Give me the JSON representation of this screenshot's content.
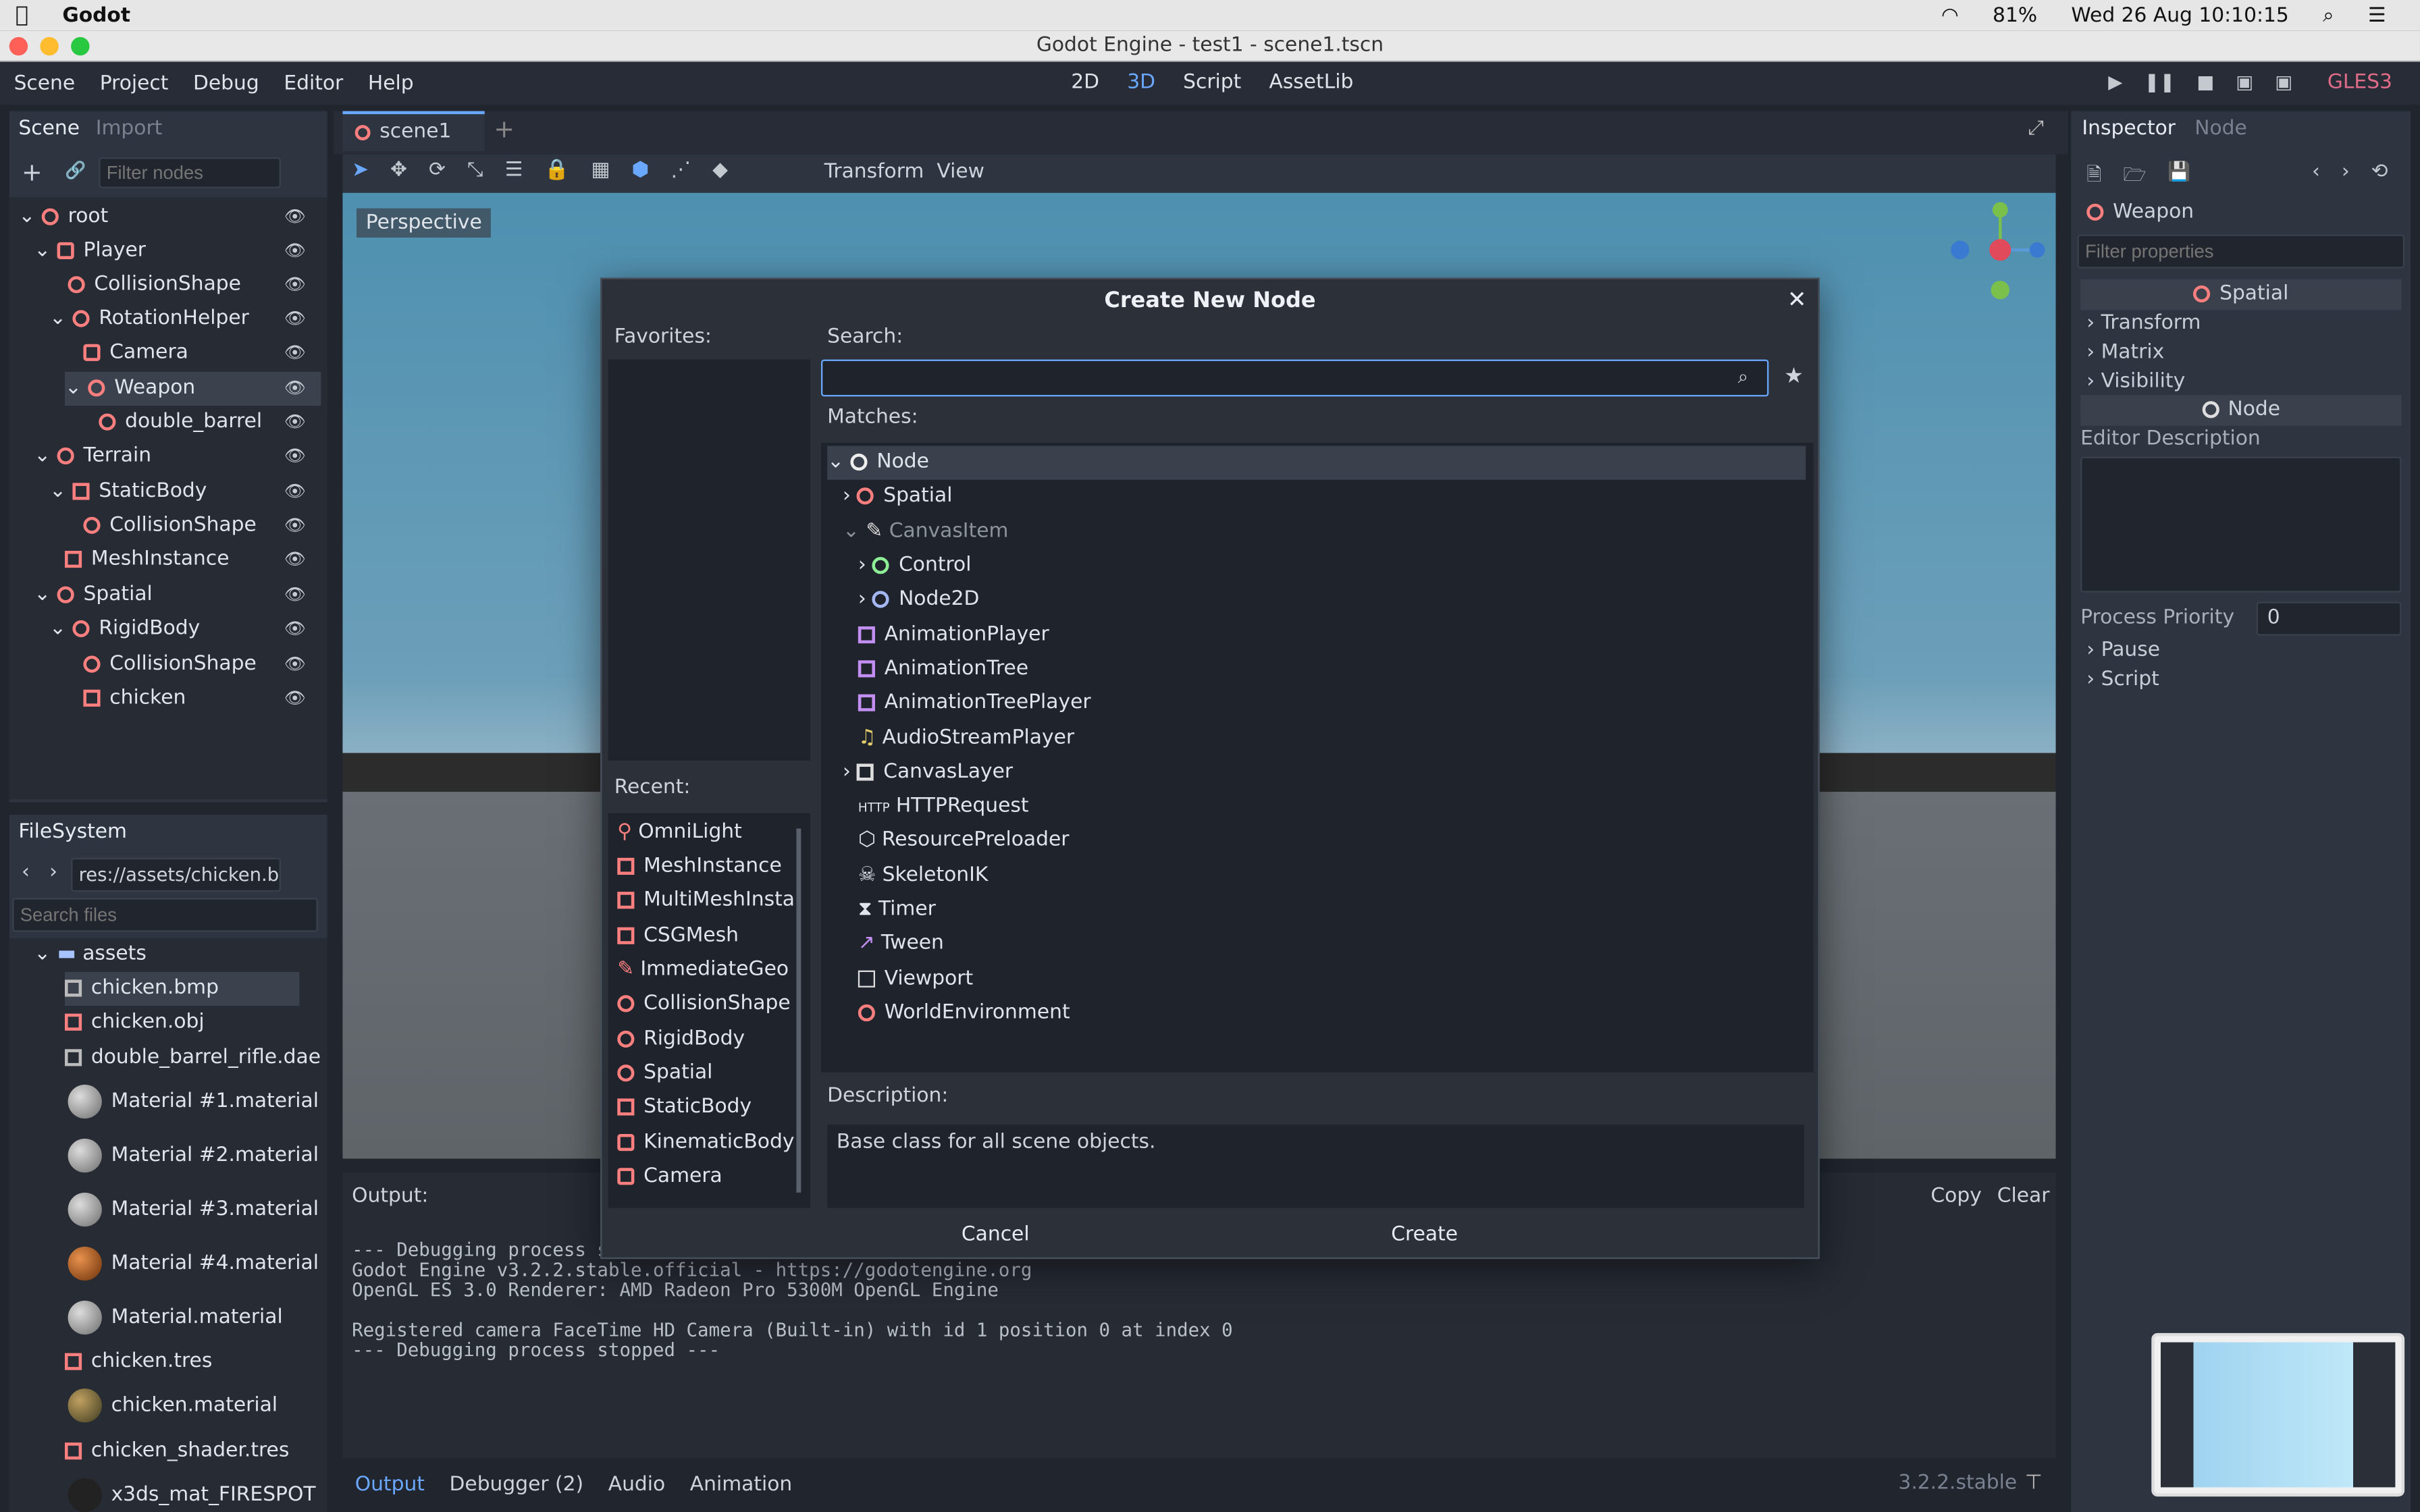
{
  "mac_menubar": {
    "app": "Godot",
    "battery": "81%",
    "datetime": "Wed 26 Aug  10:10:15"
  },
  "window": {
    "title": "Godot Engine - test1 - scene1.tscn"
  },
  "main_menu": [
    "Scene",
    "Project",
    "Debug",
    "Editor",
    "Help"
  ],
  "workspaces": [
    "2D",
    "3D",
    "Script",
    "AssetLib"
  ],
  "renderer": "GLES3",
  "scene_dock": {
    "tab_scene": "Scene",
    "tab_import": "Import",
    "filter_placeholder": "Filter nodes",
    "nodes": [
      "root",
      "Player",
      "CollisionShape",
      "RotationHelper",
      "Camera",
      "Weapon",
      "double_barrel",
      "Terrain",
      "StaticBody",
      "CollisionShape",
      "MeshInstance",
      "Spatial",
      "RigidBody",
      "CollisionShape",
      "chicken"
    ]
  },
  "filesystem": {
    "title": "FileSystem",
    "path": "res://assets/chicken.b",
    "search_placeholder": "Search files",
    "items": [
      "assets",
      "chicken.bmp",
      "chicken.obj",
      "double_barrel_rifle.dae",
      "Material #1.material",
      "Material #2.material",
      "Material #3.material",
      "Material #4.material",
      "Material.material",
      "chicken.tres",
      "chicken.material",
      "chicken_shader.tres",
      "x3ds_mat_FIRESPOT"
    ]
  },
  "editor": {
    "tab": "scene1",
    "toolbar_transform": "Transform",
    "toolbar_view": "View",
    "perspective": "Perspective"
  },
  "dialog": {
    "title": "Create New Node",
    "favorites": "Favorites:",
    "search": "Search:",
    "matches": "Matches:",
    "recent": "Recent:",
    "description_label": "Description:",
    "description": "Base class for all scene objects.",
    "cancel": "Cancel",
    "create": "Create",
    "matches_list": [
      "Node",
      "Spatial",
      "CanvasItem",
      "Control",
      "Node2D",
      "AnimationPlayer",
      "AnimationTree",
      "AnimationTreePlayer",
      "AudioStreamPlayer",
      "CanvasLayer",
      "HTTPRequest",
      "ResourcePreloader",
      "SkeletonIK",
      "Timer",
      "Tween",
      "Viewport",
      "WorldEnvironment"
    ],
    "recent_list": [
      "OmniLight",
      "MeshInstance",
      "MultiMeshInsta",
      "CSGMesh",
      "ImmediateGeo",
      "CollisionShape",
      "RigidBody",
      "Spatial",
      "StaticBody",
      "KinematicBody",
      "Camera"
    ]
  },
  "output": {
    "label": "Output:",
    "copy": "Copy",
    "clear": "Clear",
    "lines": [
      "--- Debugging process sta",
      "Godot Engine v3.2.2.stable.official - https://godotengine.org",
      "OpenGL ES 3.0 Renderer: AMD Radeon Pro 5300M OpenGL Engine",
      "",
      "Registered camera FaceTime HD Camera (Built-in) with id 1 position 0 at index 0",
      "--- Debugging process stopped ---"
    ]
  },
  "bottom_tabs": [
    "Output",
    "Debugger (2)",
    "Audio",
    "Animation"
  ],
  "version": "3.2.2.stable",
  "inspector": {
    "tab_inspector": "Inspector",
    "tab_node": "Node",
    "object": "Weapon",
    "filter_placeholder": "Filter properties",
    "spatial_header": "Spatial",
    "sections": [
      "Transform",
      "Matrix",
      "Visibility"
    ],
    "node_header": "Node",
    "editor_description": "Editor Description",
    "process_priority": "Process Priority",
    "process_priority_value": "0",
    "more_sections": [
      "Pause",
      "Script"
    ]
  }
}
